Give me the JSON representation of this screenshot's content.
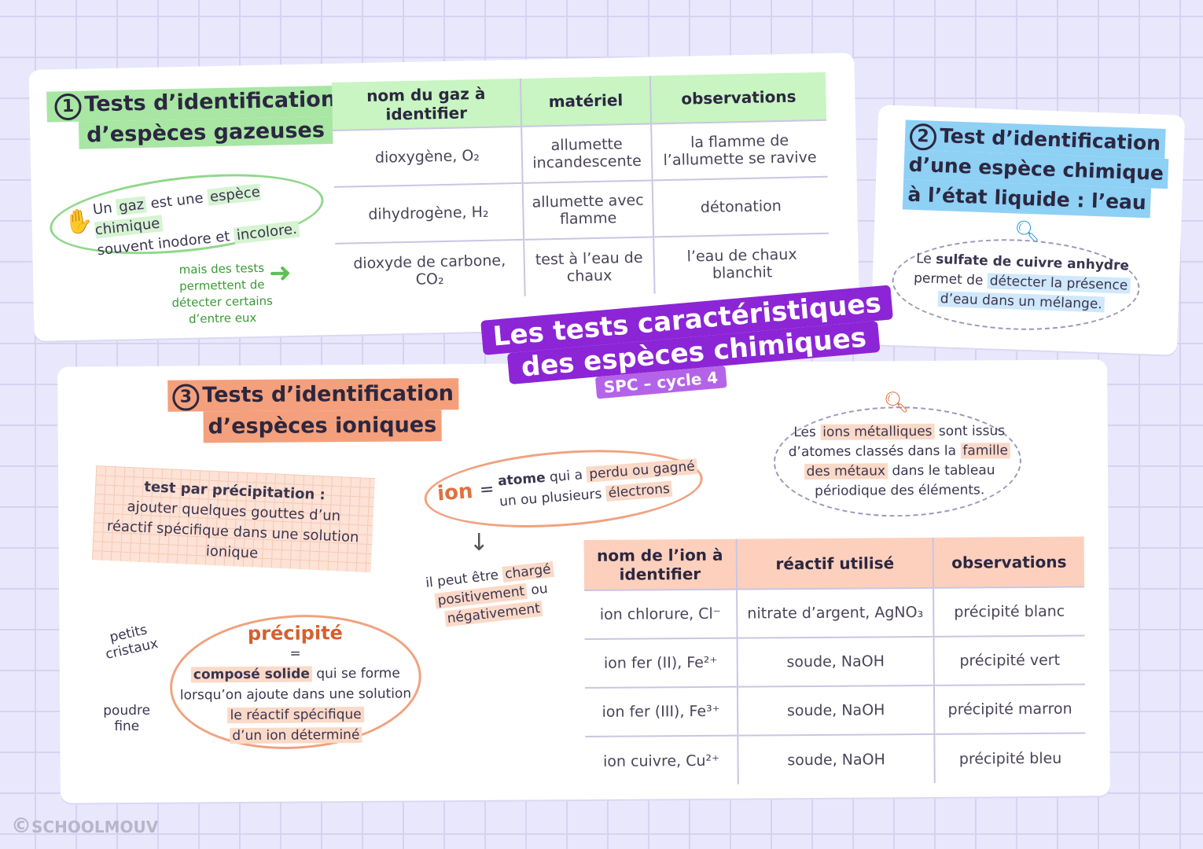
{
  "title": {
    "line1": "Les tests caractéristiques",
    "line2": "des espèces chimiques",
    "badge": "SPC – cycle 4"
  },
  "section1": {
    "number": "1",
    "title_l1": "Tests d’identification",
    "title_l2": "d’espèces gazeuses",
    "bubble": {
      "p1": "Un",
      "w1": "gaz",
      "p2": "est une",
      "w2": "espèce chimique",
      "p3": "souvent inodore",
      "p4": "et",
      "w3": "incolore."
    },
    "note": "mais des tests permettent de détecter certains d’entre eux",
    "table": {
      "headers": [
        "nom du gaz à identifier",
        "matériel",
        "observations"
      ],
      "rows": [
        [
          "dioxygène, O₂",
          "allumette incandescente",
          "la flamme de l’allumette se ravive"
        ],
        [
          "dihydrogène, H₂",
          "allumette avec flamme",
          "détonation"
        ],
        [
          "dioxyde de carbone, CO₂",
          "test à l’eau de chaux",
          "l’eau de chaux blanchit"
        ]
      ]
    }
  },
  "section2": {
    "number": "2",
    "title_l1": "Test d’identification",
    "title_l2": "d’une espèce chimique",
    "title_l3": "à l’état liquide : l’eau",
    "text": {
      "p1": "Le",
      "w1": "sulfate de cuivre anhydre",
      "p2": "permet de",
      "w2": "détecter la présence",
      "w3": "d’eau dans un mélange."
    }
  },
  "section3": {
    "number": "3",
    "title_l1": "Tests d’identification",
    "title_l2": "d’espèces ioniques",
    "note_title": "test par précipitation :",
    "note_text": "ajouter quelques gouttes d’un réactif spécifique dans une solution ionique",
    "ion": {
      "word": "ion",
      "eq": "=",
      "p1": "atome",
      "p2": "qui a",
      "w1": "perdu ou gagné",
      "w2": "un ou plusieurs",
      "w3": "électrons"
    },
    "charge": {
      "p1": "il peut être",
      "w1": "chargé",
      "w2": "positivement",
      "p2": "ou",
      "w3": "négativement"
    },
    "metal": {
      "p1": "Les",
      "w1": "ions métalliques",
      "p2": "sont issus",
      "p3": "d’atomes classés dans la",
      "w2": "famille",
      "w3": "des métaux",
      "p4": "dans le tableau",
      "p5": "périodique des éléments."
    },
    "precip": {
      "title": "précipité",
      "eq": "=",
      "w1": "composé solide",
      "p1": "qui se forme",
      "p2": "lorsqu’on ajoute dans une solution",
      "w2": "le réactif spécifique",
      "w3": "d’un ion déterminé"
    },
    "labels": {
      "crystals": "petits cristaux",
      "powder": "poudre fine"
    },
    "table": {
      "headers": [
        "nom de l’ion à identifier",
        "réactif utilisé",
        "observations"
      ],
      "rows": [
        [
          "ion chlorure, Cl⁻",
          "nitrate d’argent, AgNO₃",
          "précipité blanc"
        ],
        [
          "ion fer (II), Fe²⁺",
          "soude, NaOH",
          "précipité vert"
        ],
        [
          "ion fer (III), Fe³⁺",
          "soude, NaOH",
          "précipité marron"
        ],
        [
          "ion cuivre, Cu²⁺",
          "soude, NaOH",
          "précipité bleu"
        ]
      ]
    }
  },
  "footer": {
    "brand": "SCHOOLMOUV",
    "copyright": "©"
  },
  "colors": {
    "green": "#c8f5c2",
    "blue": "#8fd0f5",
    "orange": "#f4a07c",
    "purple": "#8c25d6",
    "header_peach": "#fdd0bd"
  }
}
